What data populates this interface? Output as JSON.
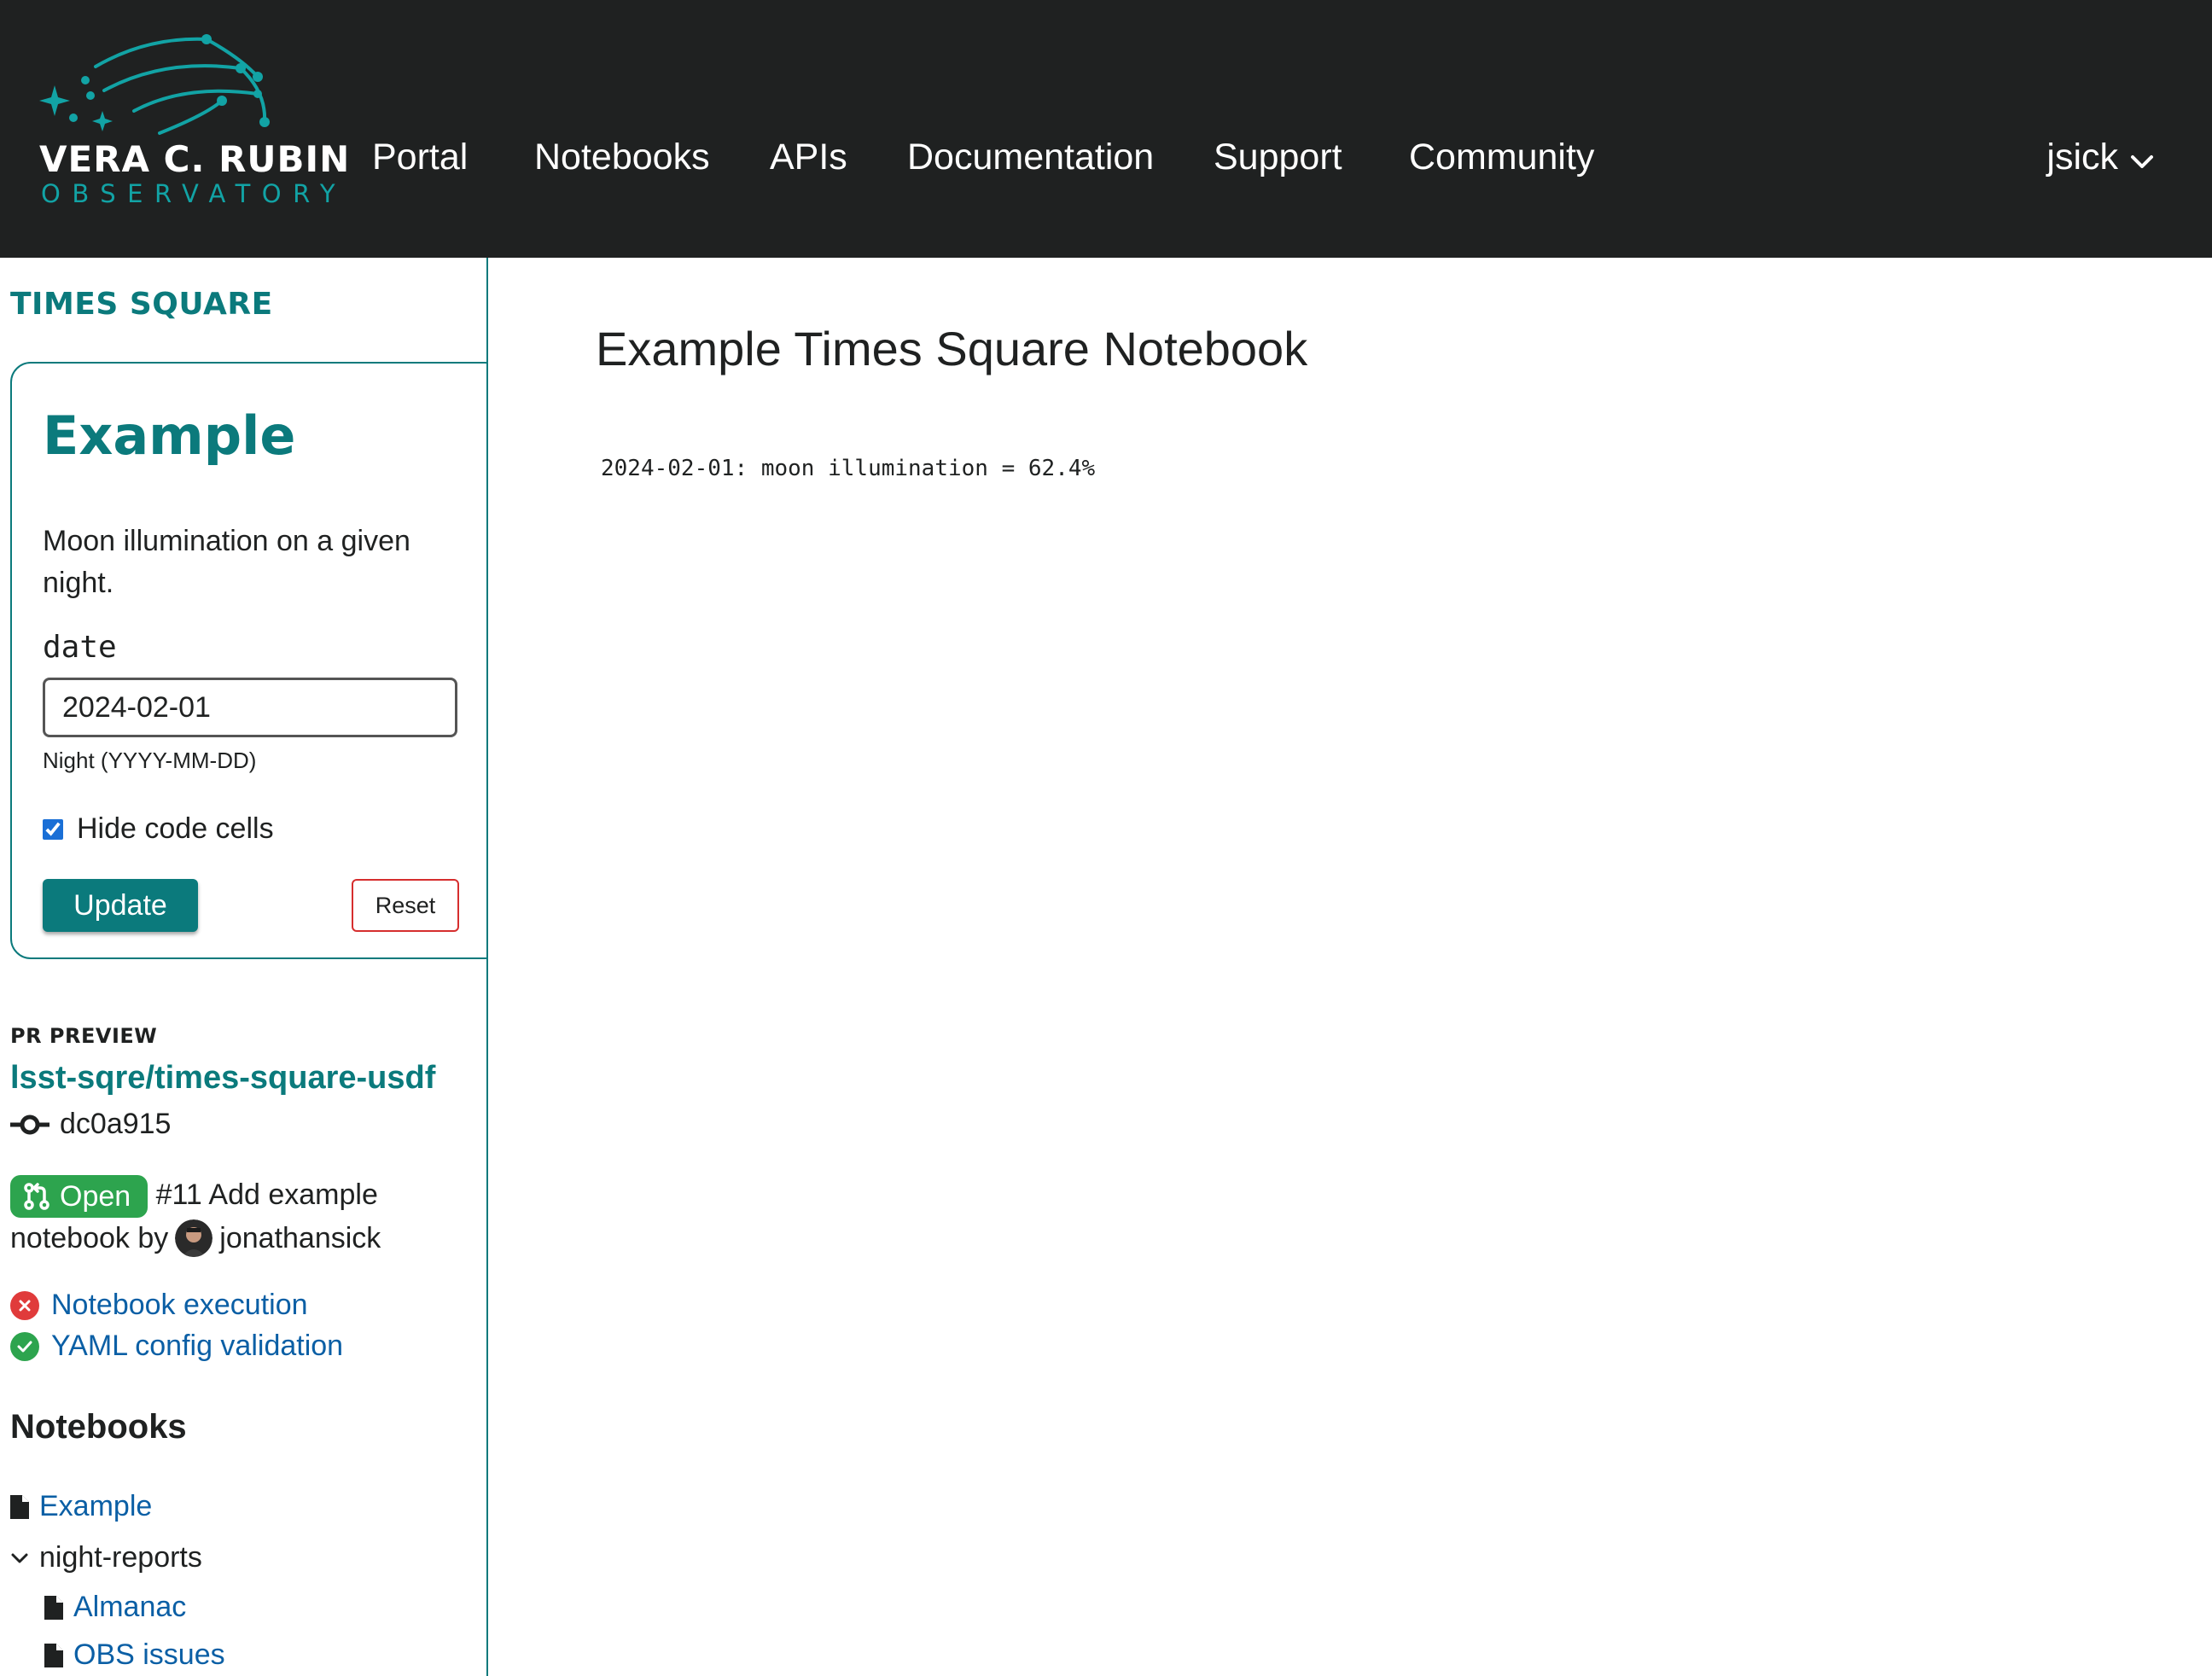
{
  "header": {
    "logo_line1": "VERA C. RUBIN",
    "logo_line2": "OBSERVATORY",
    "nav": [
      "Portal",
      "Notebooks",
      "APIs",
      "Documentation",
      "Support",
      "Community"
    ],
    "user": "jsick",
    "accent": "#12a3a5"
  },
  "sidebar": {
    "brand": "TIMES SQUARE",
    "card": {
      "title": "Example",
      "description": "Moon illumination on a given night.",
      "param_label": "date",
      "param_value": "2024-02-01",
      "param_help": "Night (YYYY-MM-DD)",
      "hide_code_label": "Hide code cells",
      "hide_code_checked": true,
      "update_label": "Update",
      "reset_label": "Reset"
    },
    "pr": {
      "heading": "PR PREVIEW",
      "repo": "lsst-sqre/times-square-usdf",
      "commit": "dc0a915",
      "state": "Open",
      "state_color": "#2da44e",
      "title": "#11 Add example notebook",
      "by": "by",
      "author": "jonathansick"
    },
    "checks": [
      {
        "name": "Notebook execution",
        "status": "failure",
        "color": "#e03b3b"
      },
      {
        "name": "YAML config validation",
        "status": "success",
        "color": "#2da44e"
      }
    ],
    "notebooks_heading": "Notebooks",
    "tree": {
      "example": "Example",
      "folder": "night-reports",
      "almanac": "Almanac",
      "obs_issues": "OBS issues"
    }
  },
  "main": {
    "title": "Example Times Square Notebook",
    "output": "2024-02-01: moon illumination = 62.4%"
  }
}
